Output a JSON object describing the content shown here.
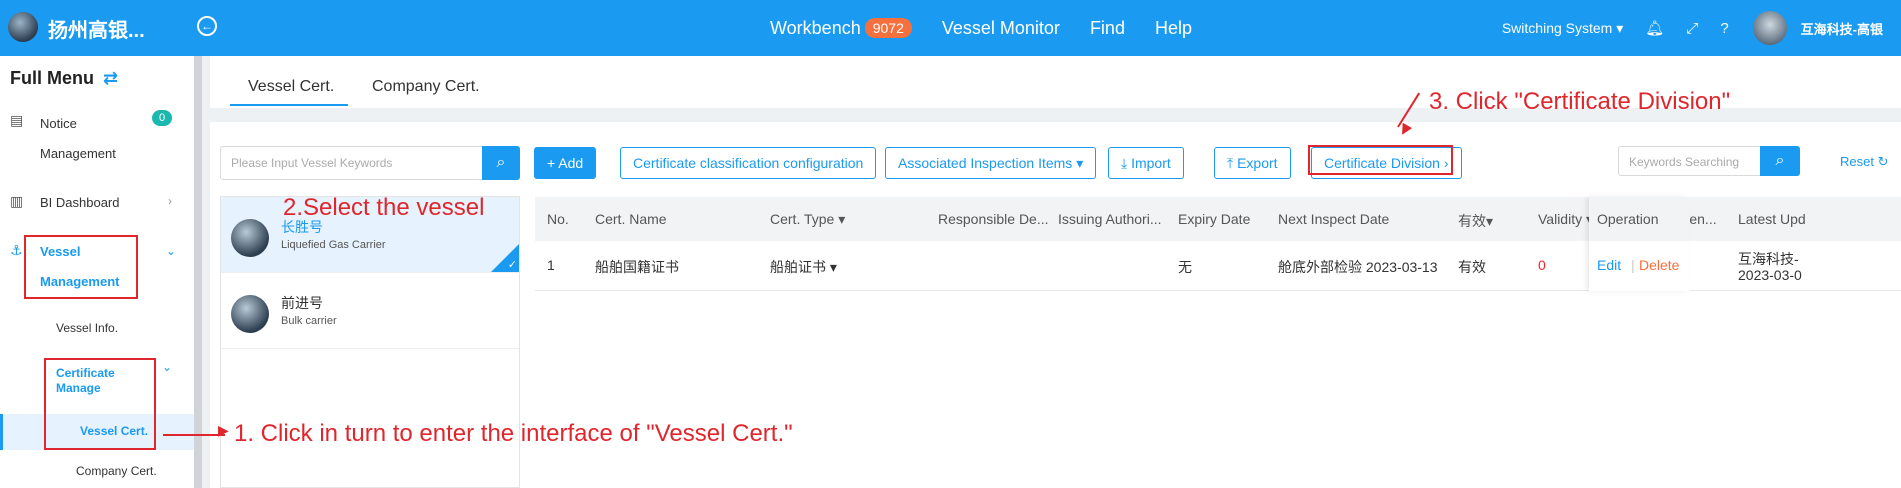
{
  "topbar": {
    "logo_text": "扬州高银...",
    "nav": [
      {
        "label": "Workbench",
        "badge": "9072"
      },
      {
        "label": "Vessel Monitor"
      },
      {
        "label": "Find"
      },
      {
        "label": "Help"
      }
    ],
    "switch_label": "Switching System ▾",
    "user_name": "互海科技-高银"
  },
  "sidebar": {
    "title": "Full Menu",
    "items": [
      {
        "label_line1": "Notice",
        "label_line2": "Management",
        "badge": "0"
      },
      {
        "label": "BI Dashboard"
      },
      {
        "label_line1": "Vessel",
        "label_line2": "Management"
      },
      {
        "label": "Vessel Info."
      },
      {
        "label_line1": "Certificate",
        "label_line2": "Manage"
      },
      {
        "label": "Vessel Cert."
      },
      {
        "label": "Company Cert."
      }
    ]
  },
  "tabs": [
    {
      "label": "Vessel Cert."
    },
    {
      "label": "Company Cert."
    }
  ],
  "vessel_search": {
    "placeholder": "Please Input Vessel Keywords"
  },
  "vessels": [
    {
      "name": "长胜号",
      "type": "Liquefied Gas Carrier"
    },
    {
      "name": "前进号",
      "type": "Bulk carrier"
    }
  ],
  "toolbar": {
    "add": "+ Add",
    "classification": "Certificate classification configuration",
    "associated": "Associated Inspection Items ▾",
    "import": "Import",
    "export": "Export",
    "division": "Certificate Division",
    "keywords_placeholder": "Keywords Searching",
    "reset": "Reset"
  },
  "table": {
    "headers": [
      "No.",
      "Cert. Name",
      "Cert. Type ▾",
      "Responsible De...",
      "Issuing Authori...",
      "Expiry Date",
      "Next Inspect Date",
      "有效▾",
      "Validity ▾",
      "Attachmen...",
      "Latest Upd",
      "Operation"
    ],
    "rows": [
      {
        "no": "1",
        "name": "船舶国籍证书",
        "type": "船舶证书 ▾",
        "responsible": "",
        "issuing": "",
        "expiry": "无",
        "next_inspect": "舱底外部检验 2023-03-13",
        "valid": "有效",
        "validity": "0",
        "attachment": "",
        "latest_update_1": "互海科技-",
        "latest_update_2": "2023-03-0",
        "edit": "Edit",
        "delete": "Delete"
      }
    ]
  },
  "annotations": {
    "step1": "1. Click in turn to enter the interface of \"Vessel Cert.\"",
    "step2": "2.Select the vessel",
    "step3": "3. Click \"Certificate Division\""
  }
}
